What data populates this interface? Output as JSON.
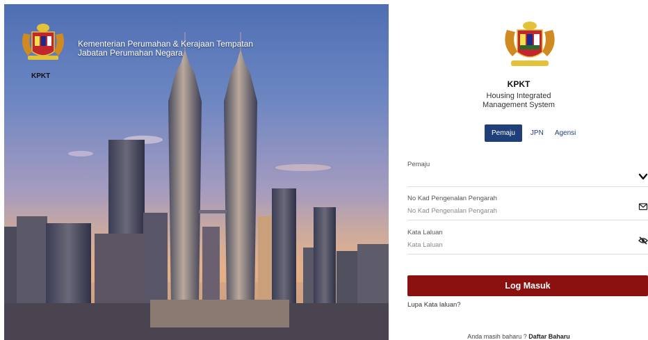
{
  "hero": {
    "ministry_line1": "Kementerian Perumahan & Kerajaan Tempatan",
    "ministry_line2": "Jabatan Perumahan Negara",
    "logo_caption": "KPKT",
    "image": "kuala-lumpur-skyline-petronas-towers"
  },
  "brand": {
    "code": "KPKT",
    "title_line1": "Housing Integrated",
    "title_line2": "Management System",
    "logo": "malaysia-coat-of-arms"
  },
  "tabs": [
    {
      "label": "Pemaju",
      "active": true
    },
    {
      "label": "JPN",
      "active": false
    },
    {
      "label": "Agensi",
      "active": false
    }
  ],
  "form": {
    "role": {
      "label": "Pemaju",
      "value": "",
      "icon": "chevron-down-icon"
    },
    "ic": {
      "label": "No Kad Pengenalan Pengarah",
      "placeholder": "No Kad Pengenalan Pengarah",
      "icon": "envelope-icon"
    },
    "password": {
      "label": "Kata Laluan",
      "placeholder": "Kata Laluan",
      "icon": "eye-slash-icon"
    },
    "submit_label": "Log Masuk",
    "forgot_label": "Lupa Kata laluan?",
    "register_prompt": "Anda masih baharu ?",
    "register_label": "Daftar Baharu"
  },
  "colors": {
    "primary_tab": "#1f3f78",
    "login_button": "#8b1010",
    "divider": "#dddddd"
  }
}
